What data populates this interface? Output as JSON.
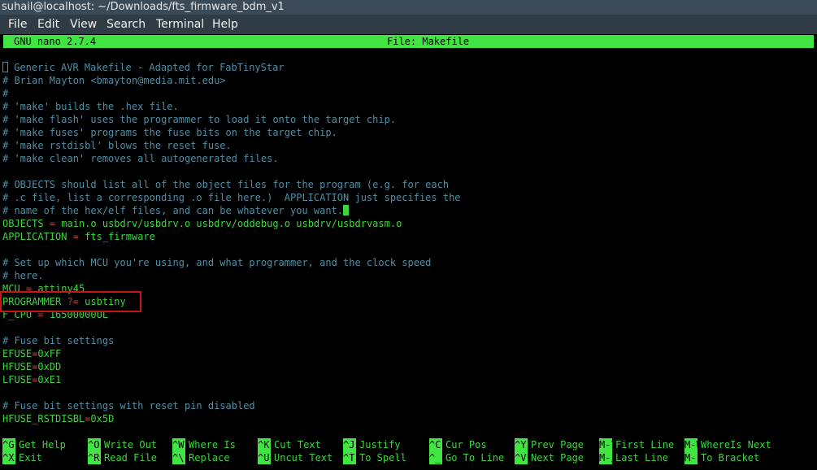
{
  "window": {
    "title": "suhail@localhost: ~/Downloads/fts_firmware_bdm_v1"
  },
  "menu": [
    "File",
    "Edit",
    "View",
    "Search",
    "Terminal",
    "Help"
  ],
  "nano": {
    "version": "GNU nano 2.7.4",
    "file_label": "File: Makefile"
  },
  "lines": [
    {
      "type": "comment",
      "text": "# Generic AVR Makefile - Adapted for FabTinyStar"
    },
    {
      "type": "comment",
      "text": "# Brian Mayton <bmayton@media.mit.edu>"
    },
    {
      "type": "comment",
      "text": "#"
    },
    {
      "type": "comment",
      "text": "# 'make' builds the .hex file."
    },
    {
      "type": "comment",
      "text": "# 'make flash' uses the programmer to load it onto the target chip."
    },
    {
      "type": "comment",
      "text": "# 'make fuses' programs the fuse bits on the target chip."
    },
    {
      "type": "comment",
      "text": "# 'make rstdisbl' blows the reset fuse."
    },
    {
      "type": "comment",
      "text": "# 'make clean' removes all autogenerated files."
    },
    {
      "type": "blank",
      "text": ""
    },
    {
      "type": "comment",
      "text": "# OBJECTS should list all of the object files for the program (e.g. for each"
    },
    {
      "type": "comment",
      "text": "# .c file, list a corresponding .o file here.)  APPLICATION just specifies the"
    },
    {
      "type": "comment",
      "text": "# name of the hex/elf files, and can be whatever you want."
    },
    {
      "type": "assign",
      "var": "OBJECTS",
      "op": " = ",
      "val": "main.o usbdrv/usbdrv.o usbdrv/oddebug.o usbdrv/usbdrvasm.o"
    },
    {
      "type": "assign",
      "var": "APPLICATION",
      "op": " = ",
      "val": "fts_firmware"
    },
    {
      "type": "blank",
      "text": ""
    },
    {
      "type": "comment",
      "text": "# Set up which MCU you're using, and what programmer, and the clock speed"
    },
    {
      "type": "comment",
      "text": "# here."
    },
    {
      "type": "assign",
      "var": "MCU",
      "op": " = ",
      "val": "attiny45"
    },
    {
      "type": "assign",
      "var": "PROGRAMMER",
      "op": " ?= ",
      "val": "usbtiny"
    },
    {
      "type": "assign",
      "var": "F_CPU",
      "op": " = ",
      "val": "16500000UL"
    },
    {
      "type": "blank",
      "text": ""
    },
    {
      "type": "comment",
      "text": "# Fuse bit settings"
    },
    {
      "type": "assign",
      "var": "EFUSE",
      "op": "=",
      "val": "0xFF"
    },
    {
      "type": "assign",
      "var": "HFUSE",
      "op": "=",
      "val": "0xDD"
    },
    {
      "type": "assign",
      "var": "LFUSE",
      "op": "=",
      "val": "0xE1"
    },
    {
      "type": "blank",
      "text": ""
    },
    {
      "type": "comment",
      "text": "# Fuse bit settings with reset pin disabled"
    },
    {
      "type": "assign",
      "var": "HFUSE_RSTDISBL",
      "op": "=",
      "val": "0x5D"
    }
  ],
  "shortcuts": [
    {
      "key": "^G",
      "label": "Get Help"
    },
    {
      "key": "^X",
      "label": "Exit"
    },
    {
      "key": "^O",
      "label": "Write Out"
    },
    {
      "key": "^R",
      "label": "Read File"
    },
    {
      "key": "^W",
      "label": "Where Is"
    },
    {
      "key": "^\\",
      "label": "Replace"
    },
    {
      "key": "^K",
      "label": "Cut Text"
    },
    {
      "key": "^U",
      "label": "Uncut Text"
    },
    {
      "key": "^J",
      "label": "Justify"
    },
    {
      "key": "^T",
      "label": "To Spell"
    },
    {
      "key": "^C",
      "label": "Cur Pos"
    },
    {
      "key": "^_",
      "label": "Go To Line"
    },
    {
      "key": "^Y",
      "label": "Prev Page"
    },
    {
      "key": "^V",
      "label": "Next Page"
    },
    {
      "key": "M-\\",
      "label": "First Line"
    },
    {
      "key": "M-/",
      "label": "Last Line"
    },
    {
      "key": "M-W",
      "label": "WhereIs Next"
    },
    {
      "key": "M-]",
      "label": "To Bracket"
    }
  ]
}
